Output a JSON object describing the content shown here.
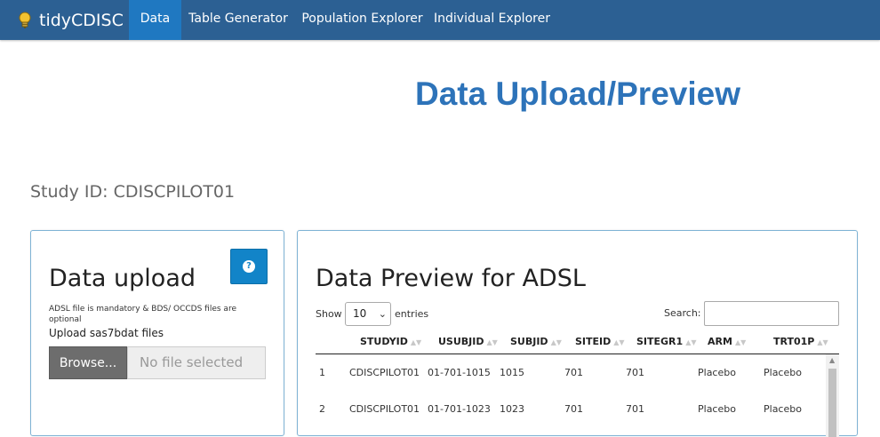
{
  "navbar": {
    "brand": "tidyCDISC",
    "items": [
      {
        "label": "Data",
        "active": true
      },
      {
        "label": "Table Generator",
        "active": false
      },
      {
        "label": "Population Explorer",
        "active": false
      },
      {
        "label": "Individual Explorer",
        "active": false
      }
    ],
    "color": "#2c6093",
    "active_color": "#1f78c1"
  },
  "page_title": "Data Upload/Preview",
  "study_id": "Study ID: CDISCPILOT01",
  "upload_panel": {
    "title": "Data upload",
    "help_icon": "question-circle-icon",
    "note": "ADSL file is mandatory & BDS/ OCCDS files are optional",
    "label": "Upload sas7bdat files",
    "browse_label": "Browse...",
    "file_placeholder": "No file selected"
  },
  "preview_panel": {
    "title": "Data Preview for ADSL",
    "show_label": "Show",
    "page_length": "10",
    "entries_label": "entries",
    "search_label": "Search:",
    "search_value": "",
    "columns": [
      "STUDYID",
      "USUBJID",
      "SUBJID",
      "SITEID",
      "SITEGR1",
      "ARM",
      "TRT01P"
    ],
    "rows": [
      {
        "index": "1",
        "cells": [
          "CDISCPILOT01",
          "01-701-1015",
          "1015",
          "701",
          "701",
          "Placebo",
          "Placebo"
        ]
      },
      {
        "index": "2",
        "cells": [
          "CDISCPILOT01",
          "01-701-1023",
          "1023",
          "701",
          "701",
          "Placebo",
          "Placebo"
        ]
      }
    ]
  }
}
